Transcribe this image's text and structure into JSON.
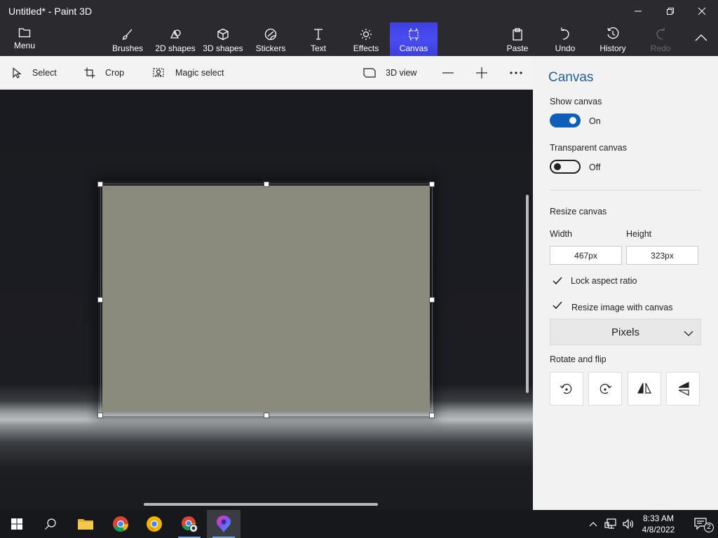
{
  "window": {
    "title": "Untitled* - Paint 3D"
  },
  "ribbon": {
    "menu": "Menu",
    "tools": [
      "Brushes",
      "2D shapes",
      "3D shapes",
      "Stickers",
      "Text",
      "Effects",
      "Canvas"
    ],
    "active_tool": "Canvas",
    "right": [
      "Paste",
      "Undo",
      "History",
      "Redo"
    ]
  },
  "toolbar": {
    "select": "Select",
    "crop": "Crop",
    "magic_select": "Magic select",
    "view_3d": "3D view"
  },
  "panel": {
    "title": "Canvas",
    "show_canvas_label": "Show canvas",
    "show_canvas_state": "On",
    "transparent_label": "Transparent canvas",
    "transparent_state": "Off",
    "resize_label": "Resize canvas",
    "width_label": "Width",
    "height_label": "Height",
    "width_value": "467px",
    "height_value": "323px",
    "lock_aspect": "Lock aspect ratio",
    "resize_image": "Resize image with canvas",
    "units": "Pixels",
    "rotate_flip": "Rotate and flip"
  },
  "taskbar": {
    "time": "8:33 AM",
    "date": "4/8/2022",
    "notifications": "2"
  },
  "colors": {
    "accent": "#0f5fb8",
    "ribbon_active": "#4a4df2",
    "canvas_fill": "#8a8b7c"
  }
}
